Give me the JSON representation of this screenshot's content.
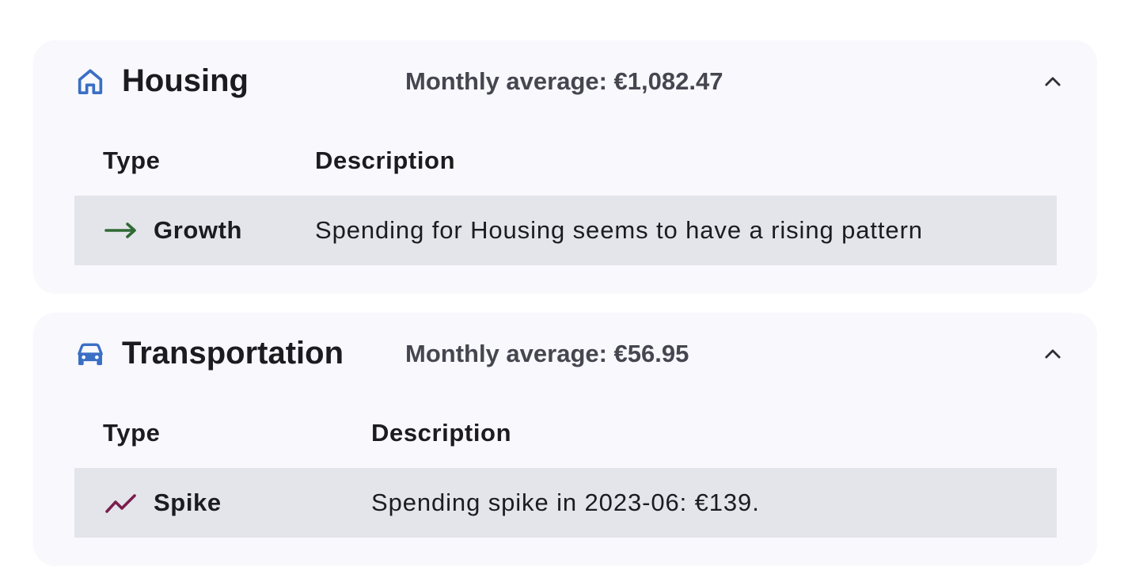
{
  "categories": [
    {
      "name": "Housing",
      "icon": "house-icon",
      "monthly_average": "Monthly average: €1,082.47",
      "table_headers": {
        "type": "Type",
        "description": "Description"
      },
      "rows": [
        {
          "type": "Growth",
          "icon": "arrow-right-icon",
          "description": "Spending for Housing seems to have a rising pattern"
        }
      ]
    },
    {
      "name": "Transportation",
      "icon": "car-icon",
      "monthly_average": "Monthly average: €56.95",
      "table_headers": {
        "type": "Type",
        "description": "Description"
      },
      "rows": [
        {
          "type": "Spike",
          "icon": "trending-up-icon",
          "description": "Spending spike in 2023-06: €139."
        }
      ]
    }
  ],
  "colors": {
    "category_icon": "#3a6fc4",
    "growth_icon": "#2f6a34",
    "spike_icon": "#7a1e4e",
    "card_background": "#f8f8fd",
    "row_background": "#e4e5ea"
  }
}
